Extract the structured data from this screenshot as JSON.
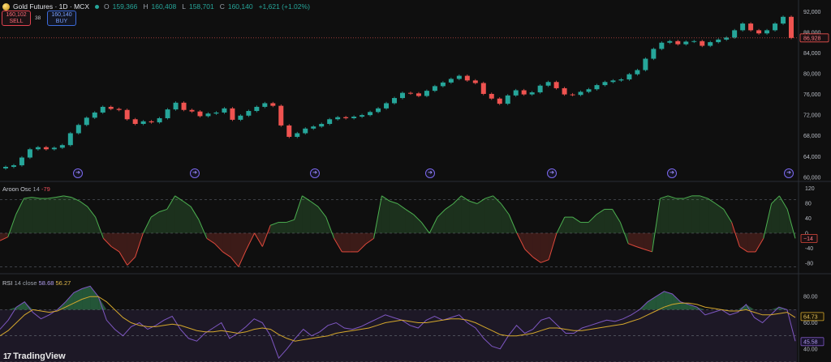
{
  "header": {
    "symbol": "Gold Futures · 1D · MCX",
    "open_label": "O",
    "open": "159,366",
    "high_label": "H",
    "high": "160,408",
    "low_label": "L",
    "low": "158,701",
    "close_label": "C",
    "close": "160,140",
    "change": "+1,621 (+1.02%)"
  },
  "trade": {
    "sell_price": "160,102",
    "sell_label": "SELL",
    "spread": "38",
    "buy_price": "160,140",
    "buy_label": "BUY"
  },
  "aroon": {
    "name": "Aroon Osc",
    "length": "14",
    "value": "-79",
    "badge": "−14"
  },
  "rsi": {
    "name": "RSI",
    "params": "14 close",
    "value": "58.68",
    "ma_value": "56.27",
    "badge_ma": "64.73",
    "badge_rsi": "45.58"
  },
  "branding": {
    "logo_text": "TradingView"
  },
  "colors": {
    "up": "#26a69a",
    "down": "#ef5350",
    "rsi_line": "#7e57c2",
    "rsi_ma": "#d4a72c",
    "aroon_pos": "#4caf50",
    "aroon_neg": "#e0493c"
  },
  "chart_data": [
    {
      "type": "candlestick",
      "title": "Gold Futures · 1D · MCX",
      "y_ticks": [
        60000,
        64000,
        68000,
        72000,
        76000,
        80000,
        84000,
        88000,
        92000
      ],
      "y_tick_labels": [
        "60,000",
        "64,000",
        "68,000",
        "72,000",
        "76,000",
        "80,000",
        "84,000",
        "88,000",
        "92,000"
      ],
      "ylim": [
        59500,
        93000
      ],
      "last_price_label": "86,928",
      "last_price": 86928,
      "closes": [
        62000,
        62300,
        63800,
        65400,
        65800,
        65400,
        65700,
        66200,
        68500,
        70100,
        71500,
        72500,
        73600,
        73200,
        73000,
        71200,
        70300,
        70800,
        70600,
        71400,
        73100,
        74400,
        73000,
        72700,
        71800,
        72300,
        72500,
        73300,
        71100,
        71900,
        72800,
        73600,
        74300,
        73800,
        70000,
        67800,
        68500,
        69400,
        69800,
        70300,
        71200,
        71600,
        71400,
        71700,
        72000,
        72600,
        73300,
        74300,
        75300,
        76300,
        76200,
        75700,
        76700,
        77600,
        78300,
        79000,
        79600,
        78700,
        78200,
        76100,
        75200,
        74200,
        75800,
        76800,
        76000,
        76400,
        77700,
        78400,
        77200,
        76000,
        75900,
        76500,
        77000,
        77800,
        78400,
        78700,
        78900,
        79900,
        80700,
        82900,
        84800,
        86000,
        86300,
        85700,
        86200,
        86300,
        85400,
        86100,
        86600,
        87000,
        88400,
        89700,
        88400,
        87800,
        88400,
        89700,
        91000,
        86928
      ]
    },
    {
      "type": "area",
      "title": "Aroon Osc 14",
      "y_ticks": [
        -80,
        -40,
        0,
        40,
        80,
        120
      ],
      "y_tick_labels": [
        "-80",
        "-40",
        "0",
        "40",
        "80",
        "120"
      ],
      "ylim": [
        -100,
        130
      ],
      "levels": [
        90,
        0,
        -90
      ],
      "values": [
        -20,
        -10,
        50,
        93,
        96,
        93,
        93,
        96,
        100,
        96,
        86,
        71,
        43,
        -14,
        -36,
        -50,
        -86,
        -64,
        0,
        43,
        57,
        64,
        100,
        86,
        71,
        36,
        -14,
        -28,
        -50,
        -64,
        -90,
        -43,
        0,
        -36,
        21,
        29,
        29,
        36,
        100,
        86,
        71,
        43,
        -14,
        -50,
        -50,
        -50,
        -29,
        -14,
        100,
        86,
        79,
        64,
        50,
        29,
        0,
        43,
        64,
        79,
        100,
        86,
        79,
        93,
        100,
        79,
        50,
        0,
        -43,
        -64,
        -79,
        -71,
        0,
        43,
        43,
        29,
        29,
        50,
        64,
        64,
        29,
        -28,
        -36,
        -43,
        -50,
        93,
        100,
        93,
        93,
        100,
        100,
        93,
        79,
        64,
        29,
        -36,
        -50,
        -50,
        -14,
        79,
        100,
        64,
        -14
      ]
    },
    {
      "type": "line",
      "title": "RSI 14 close",
      "y_ticks": [
        40,
        60,
        80
      ],
      "y_tick_labels": [
        "40.00",
        "60.00",
        "80.00"
      ],
      "ylim": [
        30,
        95
      ],
      "levels": [
        70,
        50,
        30
      ],
      "series": [
        {
          "name": "RSI",
          "values": [
            55,
            62,
            72,
            76,
            68,
            63,
            66,
            70,
            76,
            83,
            86,
            88,
            80,
            62,
            55,
            50,
            57,
            60,
            55,
            58,
            62,
            65,
            55,
            48,
            46,
            52,
            56,
            60,
            48,
            52,
            57,
            63,
            60,
            50,
            33,
            40,
            48,
            55,
            50,
            53,
            58,
            60,
            56,
            55,
            57,
            60,
            63,
            66,
            64,
            62,
            58,
            56,
            62,
            65,
            62,
            64,
            66,
            60,
            56,
            48,
            42,
            40,
            50,
            58,
            52,
            55,
            62,
            64,
            58,
            52,
            52,
            56,
            58,
            60,
            62,
            61,
            63,
            66,
            70,
            76,
            80,
            84,
            82,
            76,
            74,
            72,
            66,
            68,
            70,
            66,
            68,
            74,
            64,
            60,
            66,
            72,
            70,
            46
          ]
        },
        {
          "name": "RSI-based MA",
          "values": [
            50,
            54,
            60,
            66,
            70,
            69,
            68,
            69,
            72,
            75,
            78,
            80,
            80,
            76,
            70,
            64,
            60,
            58,
            57,
            57,
            58,
            59,
            58,
            56,
            54,
            53,
            53,
            54,
            53,
            52,
            53,
            55,
            56,
            55,
            51,
            48,
            46,
            47,
            48,
            49,
            50,
            52,
            53,
            54,
            55,
            56,
            58,
            60,
            61,
            62,
            61,
            60,
            60,
            61,
            62,
            63,
            63,
            62,
            60,
            57,
            54,
            51,
            50,
            50,
            51,
            52,
            54,
            56,
            56,
            55,
            54,
            54,
            55,
            56,
            57,
            58,
            59,
            61,
            63,
            66,
            69,
            72,
            74,
            75,
            75,
            74,
            72,
            71,
            70,
            69,
            69,
            70,
            68,
            66,
            66,
            67,
            68,
            64
          ]
        }
      ]
    }
  ]
}
